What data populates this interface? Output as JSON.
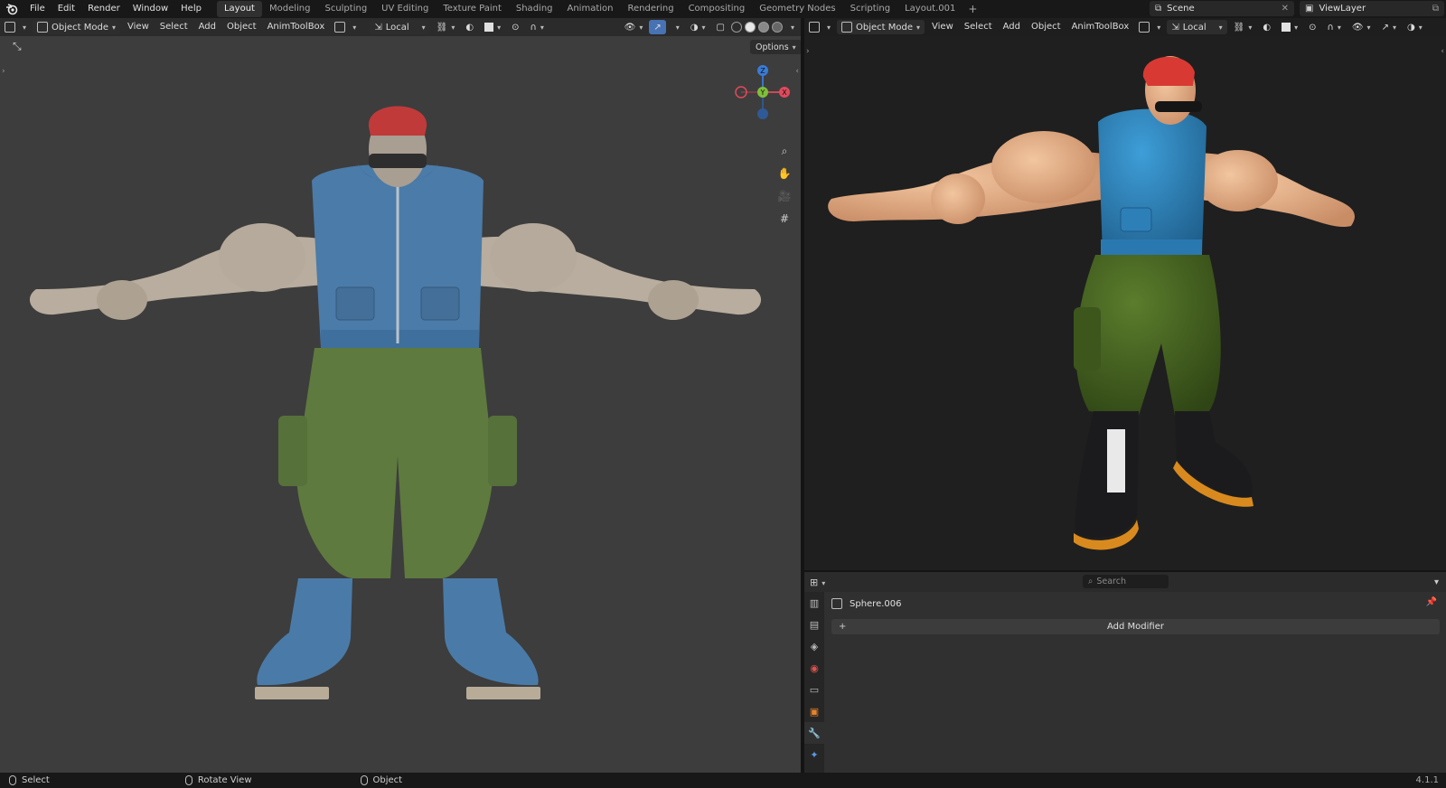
{
  "app": {
    "menus": [
      "File",
      "Edit",
      "Render",
      "Window",
      "Help"
    ],
    "workspaces": [
      "Layout",
      "Modeling",
      "Sculpting",
      "UV Editing",
      "Texture Paint",
      "Shading",
      "Animation",
      "Rendering",
      "Compositing",
      "Geometry Nodes",
      "Scripting",
      "Layout.001"
    ],
    "active_workspace": "Layout",
    "add_workspace": "+",
    "scene": "Scene",
    "view_layer": "ViewLayer"
  },
  "viewport_left": {
    "mode": "Object Mode",
    "menus": [
      "View",
      "Select",
      "Add",
      "Object",
      "AnimToolBox"
    ],
    "orientation": "Local",
    "options_label": "Options",
    "gizmo": {
      "z": "Z",
      "y": "Y",
      "x": "X"
    },
    "background": "#3d3d3d"
  },
  "viewport_right": {
    "mode": "Object Mode",
    "menus": [
      "View",
      "Select",
      "Add",
      "Object",
      "AnimToolBox"
    ],
    "orientation": "Local",
    "background": "#1f1f1f"
  },
  "properties": {
    "search_placeholder": "Search",
    "object_name": "Sphere.006",
    "add_modifier_label": "Add Modifier",
    "add_modifier_plus": "+"
  },
  "statusbar": {
    "items": [
      "Select",
      "Rotate View",
      "Object"
    ],
    "version": "4.1.1"
  },
  "colors": {
    "accent_blue": "#4772b3",
    "axis_x": "#e04a5c",
    "axis_y": "#7fbf3a",
    "axis_z": "#3a7bd5"
  }
}
